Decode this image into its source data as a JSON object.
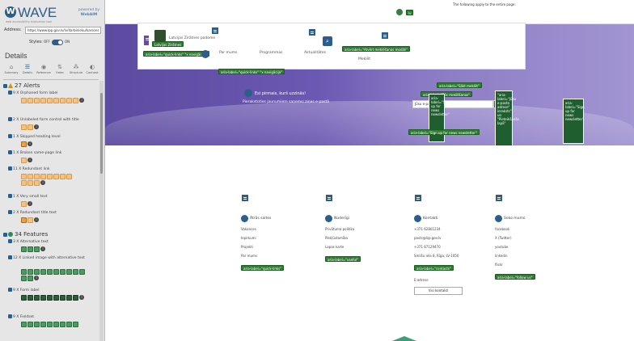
{
  "sidebar": {
    "brand_logo": "W",
    "brand_name": "WAVE",
    "brand_tagline": "web accessibility evaluation tool",
    "powered_by": "powered by",
    "powered_org": "WebAIM",
    "address_label": "Address:",
    "address_value": "https://www.lpp.gov.lv/lv/darbinieku/karsons",
    "styles_label": "Styles:",
    "styles_off": "OFF",
    "styles_on": "ON",
    "details_title": "Details",
    "tabs": [
      {
        "label": "Summary",
        "icon": "info-icon",
        "glyph": "⌂"
      },
      {
        "label": "Details",
        "icon": "list-icon",
        "glyph": "☰"
      },
      {
        "label": "Reference",
        "icon": "reference-icon",
        "glyph": "◉"
      },
      {
        "label": "Order",
        "icon": "order-icon",
        "glyph": "⇅"
      },
      {
        "label": "Structure",
        "icon": "structure-icon",
        "glyph": "⁂"
      },
      {
        "label": "Contrast",
        "icon": "contrast-icon",
        "glyph": "◐"
      }
    ],
    "alerts": {
      "title": "27 Alerts",
      "items": [
        {
          "label": "9 X Orphaned form label",
          "icons": 9,
          "info": "i"
        },
        {
          "label": "2 X Unlabeled form control with title",
          "icons": 2,
          "info": "i"
        },
        {
          "label": "1 X Skipped heading level",
          "icons": 1,
          "info": "i"
        },
        {
          "label": "1 X Broken same-page link",
          "icons": 1,
          "info": "i"
        },
        {
          "label": "11 X Redundant link",
          "icons": 11,
          "info": "i"
        },
        {
          "label": "1 X Very small text",
          "icons": 1,
          "info": "i"
        },
        {
          "label": "2 X Redundant title text",
          "icons": 2,
          "info": "i"
        }
      ]
    },
    "features": {
      "title": "34 Features",
      "items": [
        {
          "label": "3 X Alternative text",
          "icons": 3,
          "info": "i"
        },
        {
          "label": "12 X Linked image with alternative text",
          "icons": 12,
          "info": "i"
        },
        {
          "label": "9 X Form label",
          "icons": 9,
          "info": "i"
        },
        {
          "label": "9 X Fieldset",
          "icons": 3,
          "info": "i"
        }
      ]
    }
  },
  "page": {
    "apply_text": "The following apply to the entire page:",
    "lang_label": "lv",
    "site_name": "Latvijas Zirātnes padome",
    "logo_label": "Latvijas Zirātnes",
    "menu": [
      "Par mums",
      "Programmas",
      "Aktualitātes"
    ],
    "label_texts": [
      "aria-label=\"Atvērt meklēšanas modāli\"",
      "aria-label=\"Sākt meklēt\"",
      "aria-label=\"quick-links\" \"x navigācija\"",
      "Meklēt",
      "aria-label=\"Pēc meklēšanas\"",
      "aria-label=\"Nav meklētājs\""
    ],
    "hero_greeting": "Esi pirmais, kurš uzzinās!",
    "hero_sub": "Pierakstoties jaunumiem saņemsi ziņas e-pastā",
    "search_placeholder": "Jūsu e-pasts",
    "newsletter_label": "aria-label=\"Sign up for news newsletter\"",
    "panel_text": "aria-label=\"Sign up for news newsletter\"",
    "panel2_text": "\"aria-label=\"Jūsu e-pasta adrese\" ieraksts\" un \"Pieteikšanās lapā\"",
    "privacy_label": "aria-label=\"Privātuma politika\""
  },
  "footer": {
    "columns": [
      {
        "title": "Ātrās saites",
        "links": [
          "Vakances",
          "Iepirkumi",
          "Projekti",
          "Par mums"
        ],
        "label": "aria-label=\"quick-links\""
      },
      {
        "title": "Noderīgi",
        "links": [
          "Privātuma politika",
          "Piekļūstamība",
          "Lapas karte"
        ],
        "label": "aria-label=\"useful\""
      },
      {
        "title": "Kontakti",
        "links": [
          "+371 62801234",
          "pasts@lzp.gov.lv",
          "+371 67129470",
          "Smilšu iela 8, Rīga, LV-1050"
        ],
        "label": "aria-label=\"contacts\"",
        "button": "Visi kontakti",
        "extra": "E-adrese"
      },
      {
        "title": "Seko mums",
        "links": [
          "facebook",
          "X (Twitter)",
          "youtube",
          "linkedin",
          "flickr"
        ],
        "label": "aria-label=\"follow us\""
      }
    ]
  },
  "colors": {
    "hero": "#6b58b2",
    "label_green": "#2e7d32",
    "nav_blue": "#2d5d8a",
    "alert_orange": "#e08a00"
  }
}
